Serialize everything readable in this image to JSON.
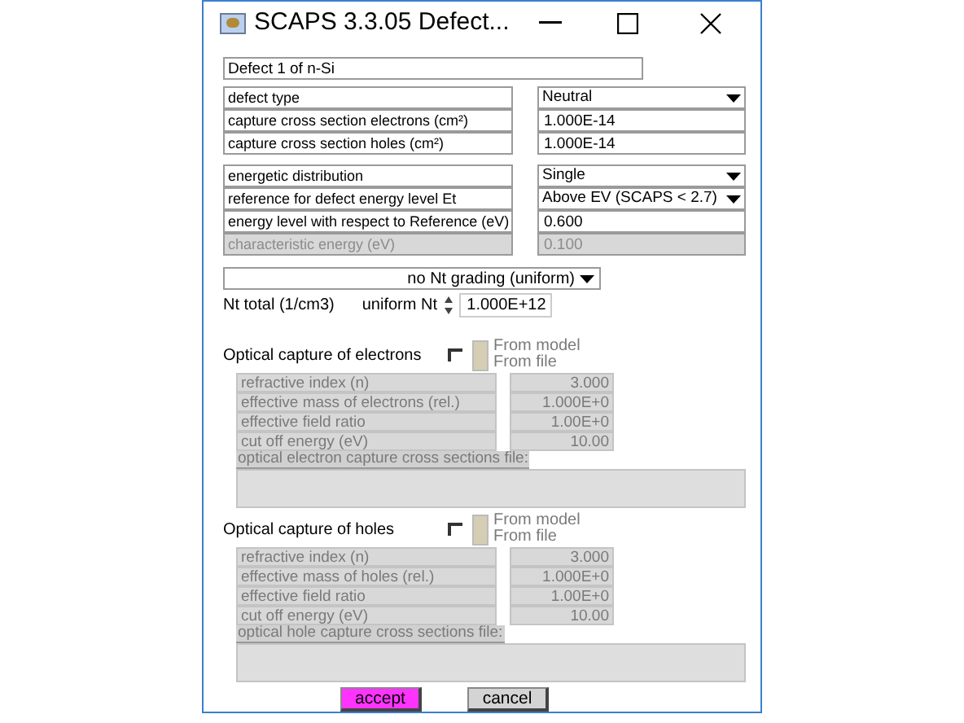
{
  "window": {
    "title": "SCAPS 3.3.05 Defect..."
  },
  "defect_name": "Defect 1 of n-Si",
  "groups": [
    [
      {
        "label": "defect type",
        "value": "Neutral",
        "kind": "select",
        "disabled": false
      },
      {
        "label": "capture cross section electrons (cm²)",
        "value": "1.000E-14",
        "kind": "input",
        "disabled": false
      },
      {
        "label": "capture cross section holes (cm²)",
        "value": "1.000E-14",
        "kind": "input",
        "disabled": false
      }
    ],
    [
      {
        "label": "energetic distribution",
        "value": "Single",
        "kind": "select",
        "disabled": false
      },
      {
        "label": "reference for defect energy level Et",
        "value": "Above EV (SCAPS < 2.7)",
        "kind": "select",
        "disabled": false
      },
      {
        "label": "energy level with respect to Reference (eV)",
        "value": "0.600",
        "kind": "input",
        "disabled": false
      },
      {
        "label": "characteristic energy (eV)",
        "value": "0.100",
        "kind": "input",
        "disabled": true
      }
    ]
  ],
  "grading": {
    "value": "no Nt grading (uniform)"
  },
  "nt_total": {
    "label": "Nt total (1/cm3)",
    "mode": "uniform Nt",
    "value": "1.000E+12"
  },
  "optical": [
    {
      "title": "Optical capture of electrons",
      "checked": false,
      "disabled": true,
      "options": [
        "From model",
        "From file"
      ],
      "rows": [
        {
          "label": "refractive index (n)",
          "value": "3.000"
        },
        {
          "label": "effective mass of electrons (rel.)",
          "value": "1.000E+0"
        },
        {
          "label": "effective field ratio",
          "value": "1.00E+0"
        },
        {
          "label": "cut off energy (eV)",
          "value": "10.00"
        }
      ],
      "file_label": "optical electron capture cross sections file:"
    },
    {
      "title": "Optical capture of holes",
      "checked": false,
      "disabled": true,
      "options": [
        "From model",
        "From file"
      ],
      "rows": [
        {
          "label": "refractive index (n)",
          "value": "3.000"
        },
        {
          "label": "effective mass of holes (rel.)",
          "value": "1.000E+0"
        },
        {
          "label": "effective field ratio",
          "value": "1.00E+0"
        },
        {
          "label": "cut off energy (eV)",
          "value": "10.00"
        }
      ],
      "file_label": "optical hole capture cross sections file:"
    }
  ],
  "buttons": [
    {
      "label": "accept",
      "kind": "primary"
    },
    {
      "label": "cancel",
      "kind": "normal"
    }
  ]
}
